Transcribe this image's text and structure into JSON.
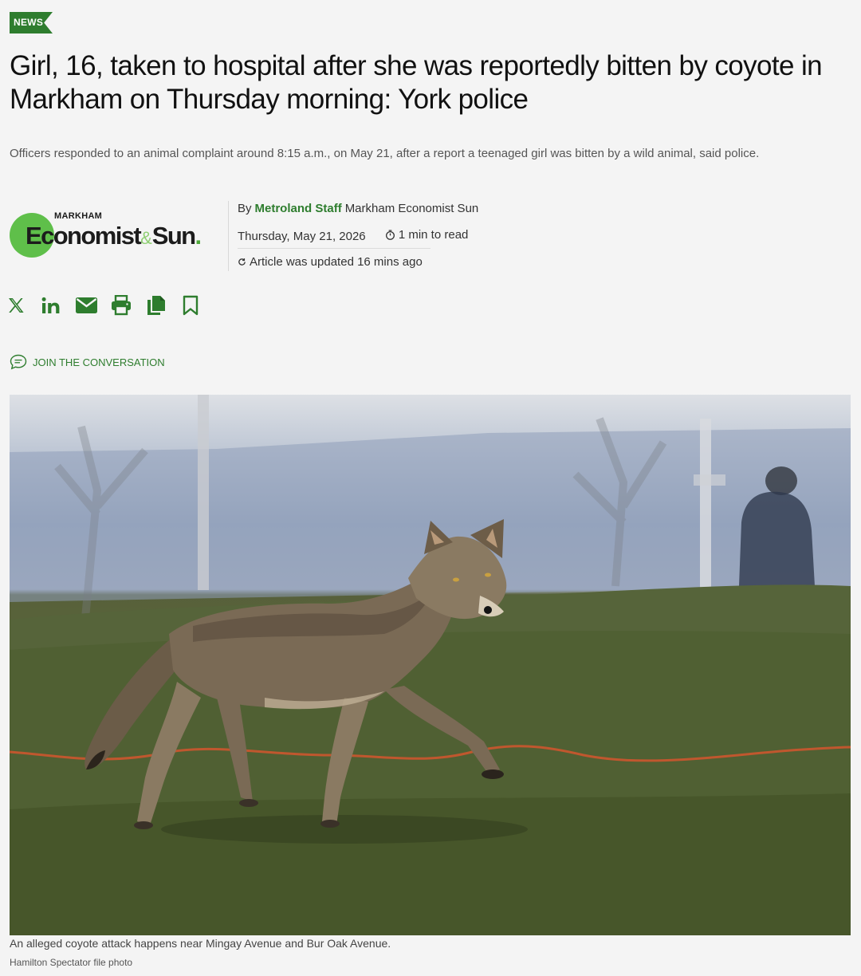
{
  "section_tag": "NEWS",
  "headline": "Girl, 16, taken to hospital after she was reportedly bitten by coyote in Markham on Thursday morning: York police",
  "subhead": "Officers responded to an animal complaint around 8:15 a.m., on May 21, after a report a teenaged girl was bitten by a wild animal, said police.",
  "publication": {
    "small_label": "MARKHAM",
    "name_part1": "Economist",
    "ampersand": "&",
    "name_part2": "Sun",
    "dot": "."
  },
  "byline": {
    "prefix": "By",
    "author": "Metroland Staff",
    "outlet": "Markham Economist Sun"
  },
  "date": "Thursday, May 21, 2026",
  "read_time": "1 min to read",
  "updated": "Article was updated 16 mins ago",
  "share_icons": [
    "x-icon",
    "linkedin-icon",
    "email-icon",
    "print-icon",
    "copy-icon",
    "bookmark-icon"
  ],
  "join_conversation": "JOIN THE CONVERSATION",
  "photo": {
    "caption": "An alleged coyote attack happens near Mingay Avenue and Bur Oak Avenue.",
    "credit": "Hamilton Spectator file photo"
  },
  "colors": {
    "accent": "#2e7d2e",
    "logo_green": "#5fbf4a",
    "background": "#f4f4f4"
  }
}
